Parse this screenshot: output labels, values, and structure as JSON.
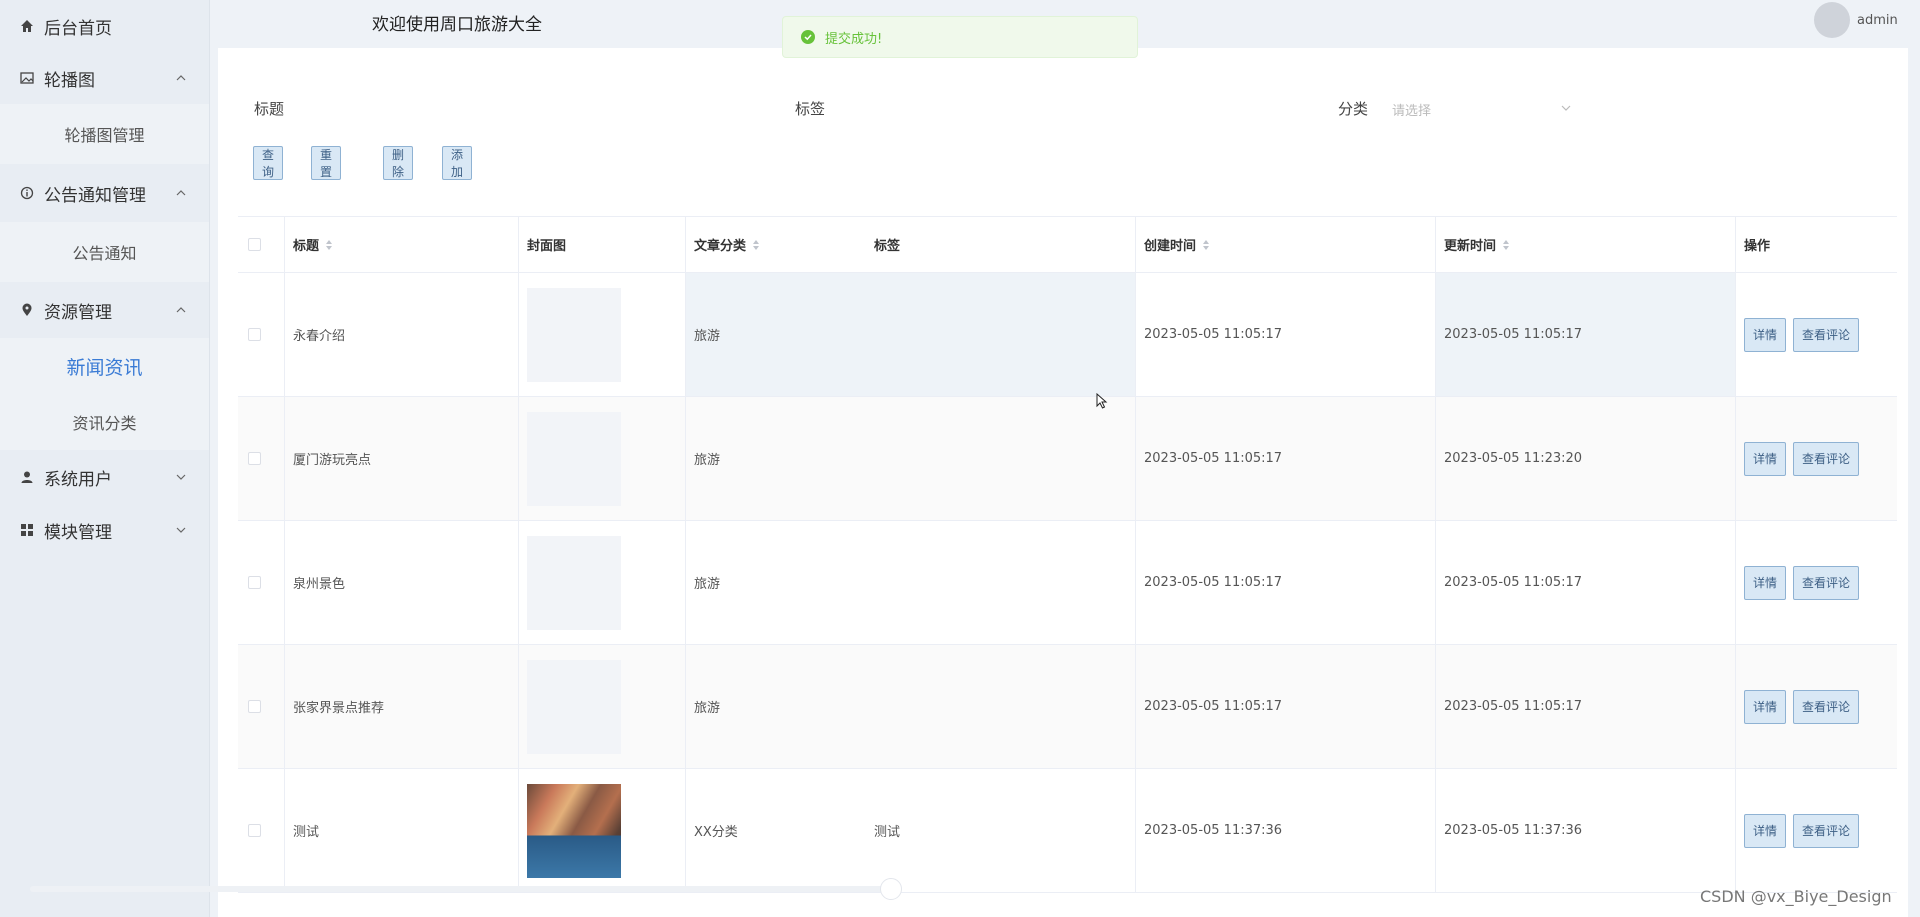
{
  "sidebar": {
    "home": "后台首页",
    "groups": [
      {
        "label": "轮播图",
        "items": [
          {
            "label": "轮播图管理"
          }
        ]
      },
      {
        "label": "公告通知管理",
        "items": [
          {
            "label": "公告通知"
          }
        ]
      },
      {
        "label": "资源管理",
        "items": [
          {
            "label": "新闻资讯"
          },
          {
            "label": "资讯分类"
          }
        ]
      },
      {
        "label": "系统用户"
      },
      {
        "label": "模块管理"
      }
    ]
  },
  "header": {
    "title": "欢迎使用周口旅游大全",
    "user": "admin"
  },
  "toast": {
    "message": "提交成功!",
    "color": "#67c23a"
  },
  "filters": {
    "title_label": "标题",
    "tag_label": "标签",
    "category_label": "分类",
    "category_placeholder": "请选择"
  },
  "buttons": {
    "query": "查询",
    "reset": "重置",
    "delete": "删除",
    "add": "添加"
  },
  "table": {
    "columns": [
      "标题",
      "封面图",
      "文章分类",
      "标签",
      "创建时间",
      "更新时间",
      "操作"
    ],
    "rows": [
      {
        "title": "永春介绍",
        "category": "旅游",
        "tag": "",
        "created": "2023-05-05 11:05:17",
        "updated": "2023-05-05 11:05:17",
        "cover": false
      },
      {
        "title": "厦门游玩亮点",
        "category": "旅游",
        "tag": "",
        "created": "2023-05-05 11:05:17",
        "updated": "2023-05-05 11:23:20",
        "cover": false
      },
      {
        "title": "泉州景色",
        "category": "旅游",
        "tag": "",
        "created": "2023-05-05 11:05:17",
        "updated": "2023-05-05 11:05:17",
        "cover": false
      },
      {
        "title": "张家界景点推荐",
        "category": "旅游",
        "tag": "",
        "created": "2023-05-05 11:05:17",
        "updated": "2023-05-05 11:05:17",
        "cover": false
      },
      {
        "title": "测试",
        "category": "XX分类",
        "tag": "测试",
        "created": "2023-05-05 11:37:36",
        "updated": "2023-05-05 11:37:36",
        "cover": true
      }
    ],
    "actions": {
      "detail": "详情",
      "comments": "查看评论"
    }
  },
  "watermark": "CSDN @vx_Biye_Design",
  "colors": {
    "accent": "#3a7bd5",
    "button_bg": "#d9e8f5",
    "button_border": "#8fb2d3"
  }
}
